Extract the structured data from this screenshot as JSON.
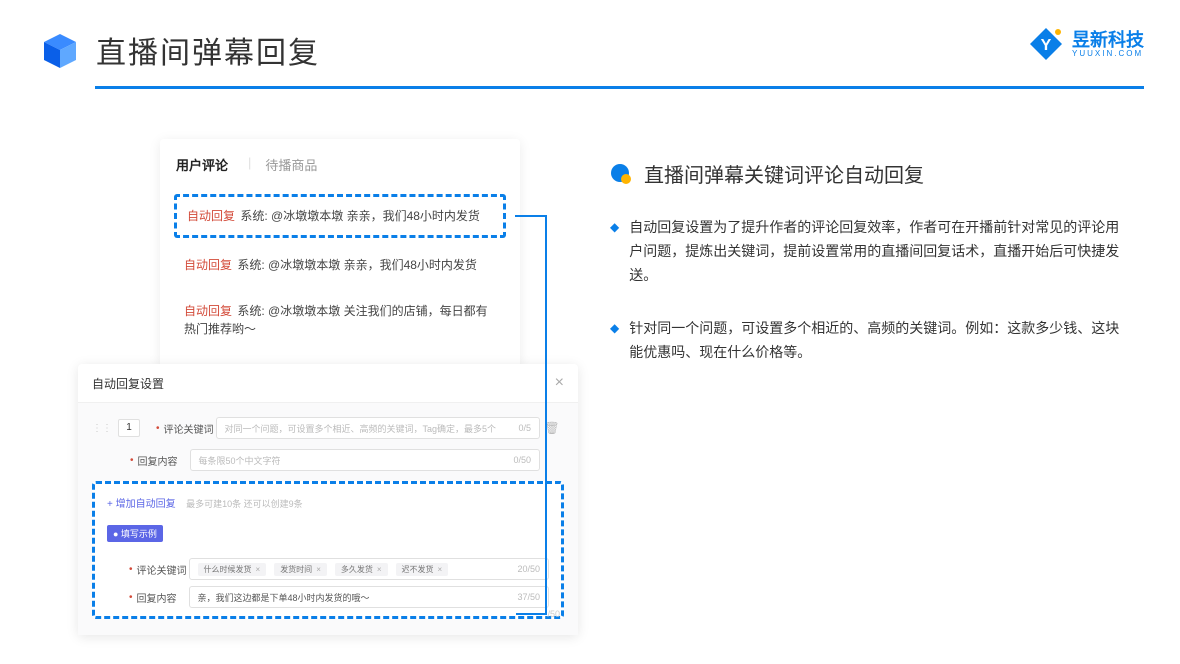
{
  "header": {
    "title": "直播间弹幕回复"
  },
  "brand": {
    "name": "昱新科技",
    "sub": "YUUXIN.COM"
  },
  "comments_card": {
    "tab_active": "用户评论",
    "tab_inactive": "待播商品",
    "reply_tag": "自动回复",
    "sys_prefix": "系统:",
    "items": [
      "@冰墩墩本墩 亲亲，我们48小时内发货",
      "@冰墩墩本墩 亲亲，我们48小时内发货",
      "@冰墩墩本墩 关注我们的店铺，每日都有热门推荐哟～"
    ]
  },
  "settings_card": {
    "title": "自动回复设置",
    "row_num": "1",
    "label_keyword": "评论关键词",
    "label_content": "回复内容",
    "ph_keyword": "对同一个问题，可设置多个相近、高频的关键词，Tag确定，最多5个",
    "ph_content": "每条限50个中文字符",
    "cnt_k": "0/5",
    "cnt_c": "0/50",
    "add_link": "+ 增加自动回复",
    "add_hint": "最多可建10条 还可以创建9条",
    "example_badge": "● 填写示例",
    "ex_tags": [
      "什么时候发货",
      "发货时间",
      "多久发货",
      "迟不发货"
    ],
    "ex_cnt_k": "20/50",
    "ex_reply": "亲，我们这边都是下单48小时内发货的哦～",
    "ex_cnt_c": "37/50",
    "outer_counter": "/50"
  },
  "right": {
    "section_title": "直播间弹幕关键词评论自动回复",
    "bullets": [
      "自动回复设置为了提升作者的评论回复效率，作者可在开播前针对常见的评论用户问题，提炼出关键词，提前设置常用的直播间回复话术，直播开始后可快捷发送。",
      "针对同一个问题，可设置多个相近的、高频的关键词。例如：这款多少钱、这块能优惠吗、现在什么价格等。"
    ]
  }
}
